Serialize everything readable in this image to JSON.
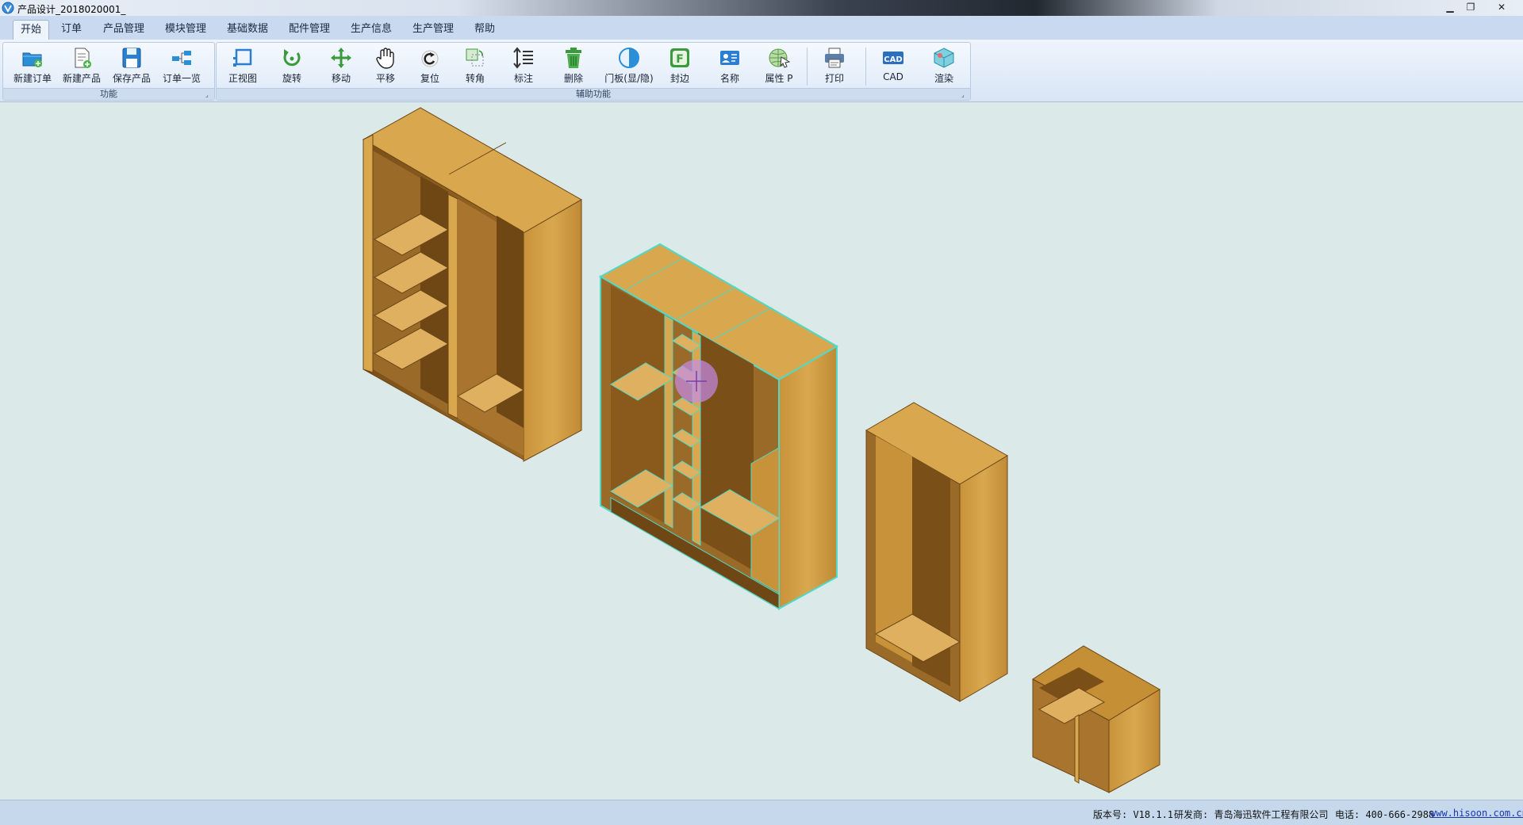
{
  "window": {
    "title": "产品设计_2018020001_"
  },
  "tabs": [
    {
      "label": "开始",
      "active": true
    },
    {
      "label": "订单"
    },
    {
      "label": "产品管理"
    },
    {
      "label": "模块管理"
    },
    {
      "label": "基础数据"
    },
    {
      "label": "配件管理"
    },
    {
      "label": "生产信息"
    },
    {
      "label": "生产管理"
    },
    {
      "label": "帮助"
    }
  ],
  "ribbon": {
    "group1": {
      "label": "功能",
      "buttons": [
        {
          "label": "新建订单",
          "icon": "folder-add-icon"
        },
        {
          "label": "新建产品",
          "icon": "document-add-icon"
        },
        {
          "label": "保存产品",
          "icon": "save-icon"
        },
        {
          "label": "订单一览",
          "icon": "order-list-icon"
        }
      ]
    },
    "group2": {
      "label": "辅助功能",
      "buttons": [
        {
          "label": "正视图",
          "icon": "front-view-icon"
        },
        {
          "label": "旋转",
          "icon": "rotate-icon"
        },
        {
          "label": "移动",
          "icon": "move-icon"
        },
        {
          "label": "平移",
          "icon": "pan-hand-icon"
        },
        {
          "label": "复位",
          "icon": "reset-icon"
        },
        {
          "label": "转角",
          "icon": "corner-icon"
        },
        {
          "label": "标注",
          "icon": "dimension-icon"
        },
        {
          "label": "删除",
          "icon": "trash-icon"
        },
        {
          "label": "门板(显/隐)",
          "icon": "door-toggle-icon"
        },
        {
          "label": "封边",
          "icon": "edge-band-icon"
        },
        {
          "label": "名称",
          "icon": "name-card-icon"
        },
        {
          "label": "属性 P",
          "icon": "properties-globe-icon"
        },
        {
          "label": "打印",
          "icon": "printer-icon"
        },
        {
          "label": "CAD",
          "icon": "cad-icon"
        },
        {
          "label": "渲染",
          "icon": "render-icon"
        }
      ]
    }
  },
  "colors": {
    "wood_light": "#d9a84e",
    "wood_mid": "#c48f35",
    "wood_dark": "#8a5a1c",
    "selection": "#4fd9c9",
    "viewport_bg": "#dbe9e8"
  },
  "status": {
    "version": "版本号: V18.1.1",
    "developer": "研发商: 青岛海迅软件工程有限公司",
    "phone": "电话: 400-666-2988",
    "website": "www.hisoon.com.cn"
  }
}
